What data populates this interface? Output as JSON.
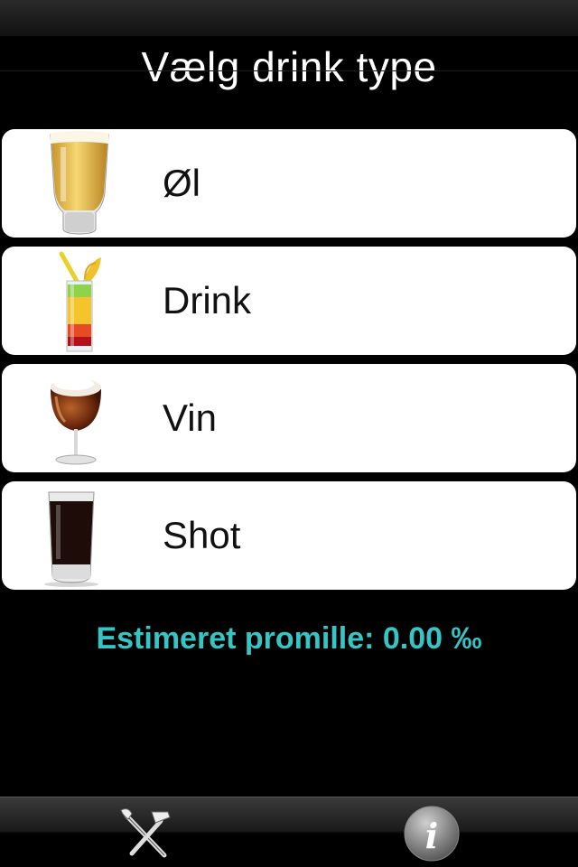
{
  "screen": {
    "title": "Vælg drink type"
  },
  "menu": {
    "items": [
      {
        "label": "Øl",
        "icon": "beer-glass-icon"
      },
      {
        "label": "Drink",
        "icon": "cocktail-glass-icon"
      },
      {
        "label": "Vin",
        "icon": "wine-glass-icon"
      },
      {
        "label": "Shot",
        "icon": "shot-glass-icon"
      }
    ]
  },
  "promille": {
    "text": "Estimeret promille: 0.00 ‰",
    "color": "#36c5c4"
  },
  "tabbar": {
    "items": [
      {
        "icon": "tools-icon"
      },
      {
        "icon": "info-icon"
      }
    ]
  }
}
